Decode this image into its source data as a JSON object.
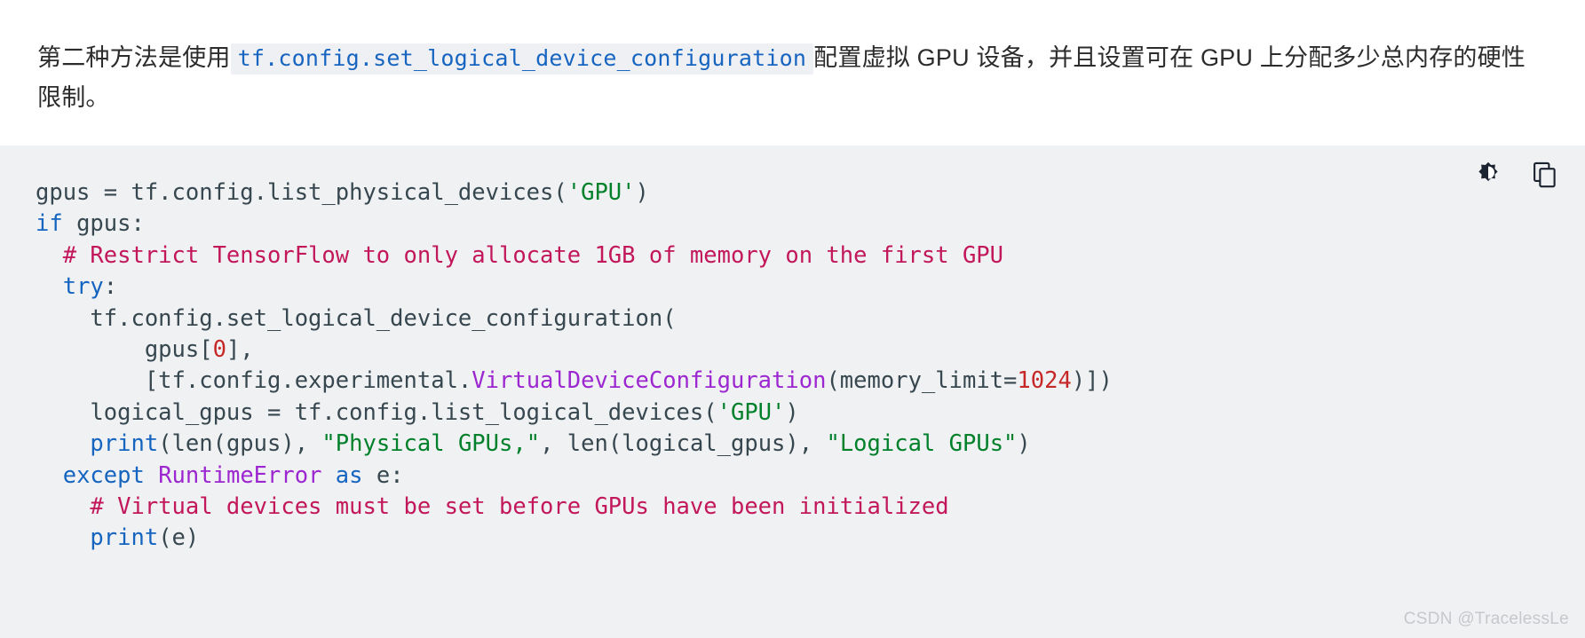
{
  "intro": {
    "text_before": "第二种方法是使用",
    "inline_code": "tf.config.set_logical_device_configuration",
    "text_after": "配置虚拟 GPU 设备，并且设置可在 GPU 上分配多少总内存的硬性限制。"
  },
  "code_block": {
    "language": "python",
    "background": "#f0f1f3",
    "toolbar": {
      "theme_toggle_label": "contrast-icon",
      "copy_label": "copy-icon"
    },
    "colors": {
      "keyword": "#1565c0",
      "class": "#9c27d0",
      "string": "#00802b",
      "comment": "#c2185b",
      "number": "#c62828",
      "plain": "#37474f"
    },
    "lines": [
      [
        {
          "t": "gpus = tf.config.list_physical_devices(",
          "c": "plain"
        },
        {
          "t": "'GPU'",
          "c": "str"
        },
        {
          "t": ")",
          "c": "plain"
        }
      ],
      [
        {
          "t": "if",
          "c": "kw"
        },
        {
          "t": " gpus:",
          "c": "plain"
        }
      ],
      [
        {
          "t": "  # Restrict TensorFlow to only allocate 1GB of memory on the first GPU",
          "c": "com"
        }
      ],
      [
        {
          "t": "  ",
          "c": "plain"
        },
        {
          "t": "try",
          "c": "kw"
        },
        {
          "t": ":",
          "c": "plain"
        }
      ],
      [
        {
          "t": "    tf.config.set_logical_device_configuration(",
          "c": "plain"
        }
      ],
      [
        {
          "t": "        gpus[",
          "c": "plain"
        },
        {
          "t": "0",
          "c": "num"
        },
        {
          "t": "],",
          "c": "plain"
        }
      ],
      [
        {
          "t": "        [tf.config.experimental.",
          "c": "plain"
        },
        {
          "t": "VirtualDeviceConfiguration",
          "c": "cls"
        },
        {
          "t": "(memory_limit=",
          "c": "plain"
        },
        {
          "t": "1024",
          "c": "num"
        },
        {
          "t": ")])",
          "c": "plain"
        }
      ],
      [
        {
          "t": "    logical_gpus = tf.config.list_logical_devices(",
          "c": "plain"
        },
        {
          "t": "'GPU'",
          "c": "str"
        },
        {
          "t": ")",
          "c": "plain"
        }
      ],
      [
        {
          "t": "    ",
          "c": "plain"
        },
        {
          "t": "print",
          "c": "fn"
        },
        {
          "t": "(len(gpus), ",
          "c": "plain"
        },
        {
          "t": "\"Physical GPUs,\"",
          "c": "str"
        },
        {
          "t": ", len(logical_gpus), ",
          "c": "plain"
        },
        {
          "t": "\"Logical GPUs\"",
          "c": "str"
        },
        {
          "t": ")",
          "c": "plain"
        }
      ],
      [
        {
          "t": "  ",
          "c": "plain"
        },
        {
          "t": "except",
          "c": "kw"
        },
        {
          "t": " ",
          "c": "plain"
        },
        {
          "t": "RuntimeError",
          "c": "cls"
        },
        {
          "t": " ",
          "c": "plain"
        },
        {
          "t": "as",
          "c": "kw"
        },
        {
          "t": " e:",
          "c": "plain"
        }
      ],
      [
        {
          "t": "    # Virtual devices must be set before GPUs have been initialized",
          "c": "com"
        }
      ],
      [
        {
          "t": "    ",
          "c": "plain"
        },
        {
          "t": "print",
          "c": "fn"
        },
        {
          "t": "(e)",
          "c": "plain"
        }
      ]
    ]
  },
  "watermark": {
    "text": "CSDN @TracelessLe"
  }
}
